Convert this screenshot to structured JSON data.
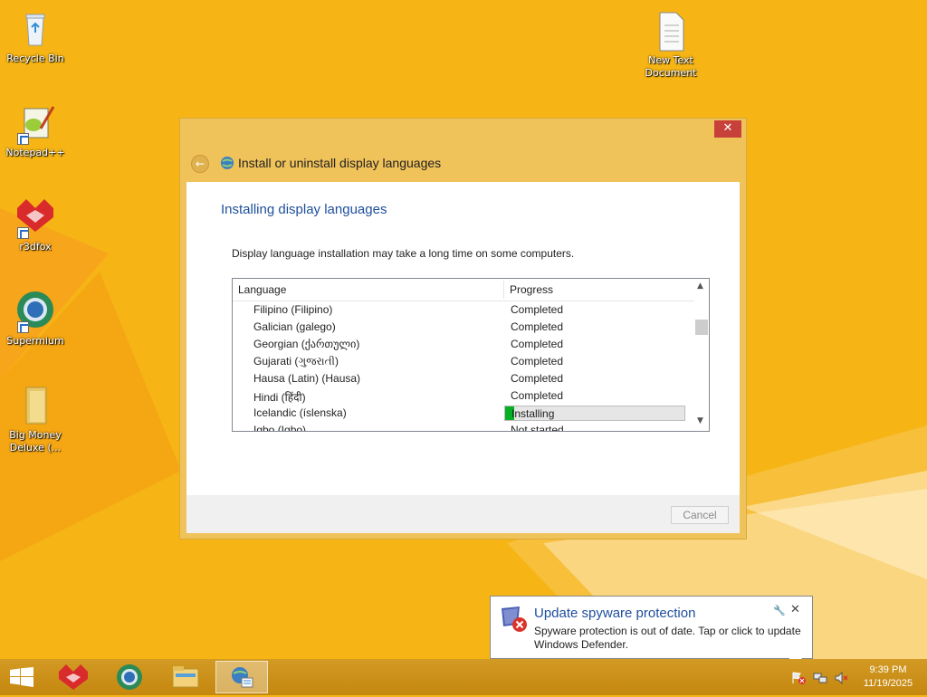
{
  "desktop": {
    "icons_left": [
      {
        "label": "Recycle Bin",
        "icon": "recycle-bin-icon"
      },
      {
        "label": "Notepad++",
        "icon": "notepad-plus-plus-icon"
      },
      {
        "label": "r3dfox",
        "icon": "r3dfox-icon"
      },
      {
        "label": "Supermium",
        "icon": "supermium-icon"
      },
      {
        "label": "Big Money Deluxe (...",
        "icon": "folder-icon"
      }
    ],
    "icon_right": {
      "label": "New Text Document",
      "icon": "text-document-icon"
    }
  },
  "window": {
    "title": "Install or uninstall display languages",
    "heading": "Installing display languages",
    "info": "Display language installation may take a long time on some computers.",
    "columns": {
      "language": "Language",
      "progress": "Progress"
    },
    "rows": [
      {
        "language": "Filipino (Filipino)",
        "status": "Completed"
      },
      {
        "language": "Galician (galego)",
        "status": "Completed"
      },
      {
        "language": "Georgian (ქართული)",
        "status": "Completed"
      },
      {
        "language": "Gujarati (ગુજરાતી)",
        "status": "Completed"
      },
      {
        "language": "Hausa (Latin) (Hausa)",
        "status": "Completed"
      },
      {
        "language": "Hindi (हिंदी)",
        "status": "Completed"
      },
      {
        "language": "Icelandic (íslenska)",
        "status": "Installing",
        "progress_fraction": 0.05
      },
      {
        "language": "Igbo (Igbo)",
        "status": "Not started"
      }
    ],
    "cancel_label": "Cancel",
    "close_symbol": "✕",
    "back_symbol": "←"
  },
  "notification": {
    "title": "Update spyware protection",
    "body": "Spyware protection is out of date. Tap or click to update Windows Defender.",
    "close_symbol": "✕"
  },
  "taskbar": {
    "apps": [
      "r3dfox-icon",
      "supermium-icon",
      "file-explorer-icon",
      "language-settings-icon"
    ],
    "time": "9:39 PM",
    "date": "11/19/2025"
  },
  "colors": {
    "desktop": "#f6b515",
    "accent_blue": "#1e4f9c",
    "progress_green": "#06b025",
    "close_red": "#c7413a"
  }
}
